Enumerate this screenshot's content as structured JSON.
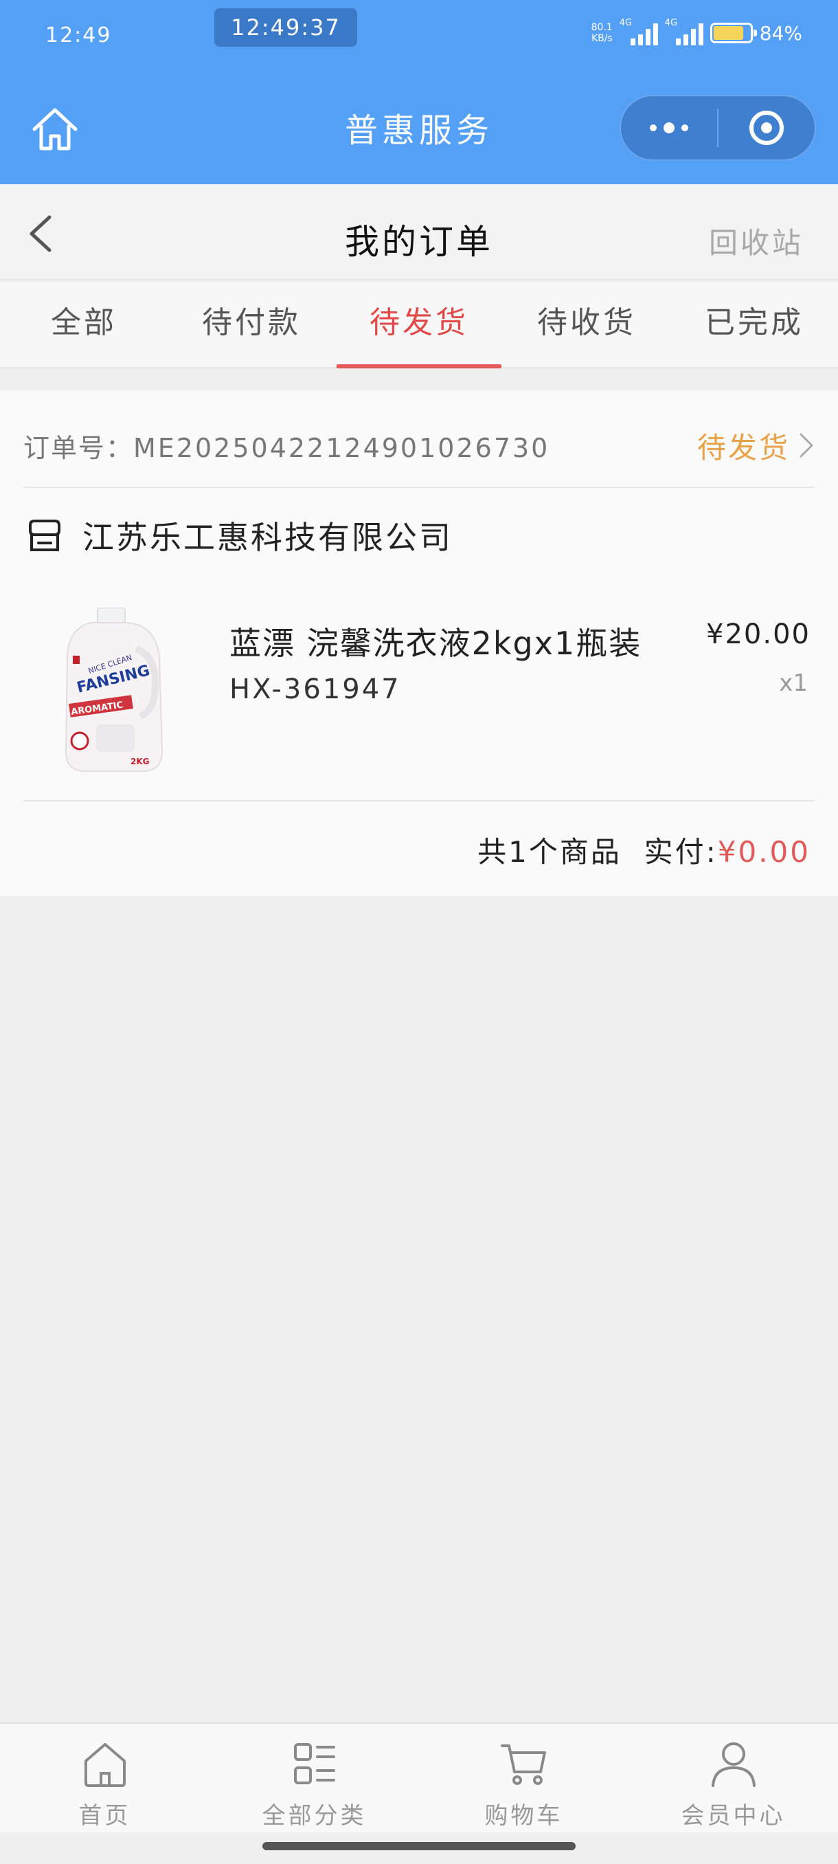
{
  "status_bar": {
    "time": "12:49",
    "clock_overlay": "12:49:37",
    "net_speed_value": "80.1",
    "net_speed_unit": "KB/s",
    "signal_1_label": "4G",
    "signal_2_label": "4G",
    "battery_percent": "84%",
    "battery_level": 0.84,
    "battery_color": "#f7d45c"
  },
  "mini_program": {
    "title": "普惠服务",
    "home_icon": "home-icon",
    "more_icon": "more-dots-icon",
    "close_icon": "target-close-icon"
  },
  "nav": {
    "back_icon": "chevron-left-icon",
    "title": "我的订单",
    "recycle_label": "回收站"
  },
  "tabs": [
    {
      "label": "全部",
      "active": false
    },
    {
      "label": "待付款",
      "active": false
    },
    {
      "label": "待发货",
      "active": true
    },
    {
      "label": "待收货",
      "active": false
    },
    {
      "label": "已完成",
      "active": false
    }
  ],
  "order": {
    "order_no_label": "订单号：",
    "order_no": "ME20250422124901026730",
    "status": "待发货",
    "shop_icon": "store-icon",
    "shop_name": "江苏乐工惠科技有限公司",
    "product": {
      "name": "蓝漂 浣馨洗衣液2kgx1瓶装",
      "spec": "HX-361947",
      "price": "¥20.00",
      "qty": "x1",
      "image_icon": "detergent-bottle-image"
    },
    "summary_count": "共1个商品",
    "summary_paid_label": "实付:",
    "summary_paid": "¥0.00"
  },
  "bottom_tabs": [
    {
      "label": "首页",
      "icon": "home-icon"
    },
    {
      "label": "全部分类",
      "icon": "category-icon"
    },
    {
      "label": "购物车",
      "icon": "cart-icon"
    },
    {
      "label": "会员中心",
      "icon": "user-icon"
    }
  ],
  "colors": {
    "header_blue": "#55a0f7",
    "tab_active": "#e04a48",
    "status_orange": "#e8a24a",
    "price_red": "#e05a5a"
  }
}
